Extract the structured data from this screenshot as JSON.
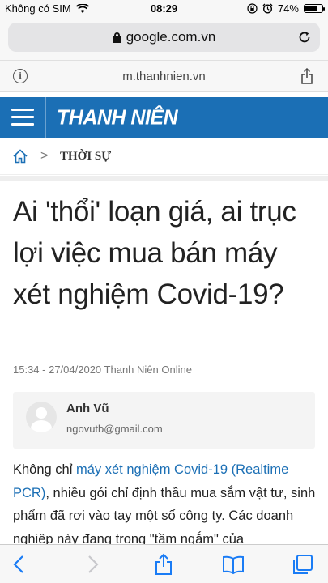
{
  "status_bar": {
    "carrier": "Không có SIM",
    "time": "08:29",
    "battery": "74%",
    "battery_level": 0.74,
    "icons": [
      "wifi-icon",
      "lock-rotation-icon",
      "alarm-icon",
      "battery-icon"
    ]
  },
  "browser": {
    "url": "google.com.vn",
    "amp_url": "m.thanhnien.vn",
    "icons": [
      "lock-icon",
      "reload-icon",
      "info-icon",
      "share-icon"
    ]
  },
  "site": {
    "logo": "THANH NIÊN",
    "brand_color": "#1b6fb5"
  },
  "breadcrumb": {
    "section": "THỜI SỰ",
    "separator": ">"
  },
  "article": {
    "title": "Ai 'thổi' loạn giá, ai trục lợi việc mua bán máy xét nghiệm Covid-19?",
    "time": "15:34",
    "date_source": " - 27/04/2020 Thanh Niên Online",
    "author": {
      "name": "Anh Vũ",
      "email": "ngovutb@gmail.com"
    },
    "body": {
      "prefix": "Không chỉ ",
      "link": "máy xét nghiệm Covid-19 (Realtime PCR)",
      "rest": ", nhiều gói chỉ định thầu mua sắm vật tư, sinh phẩm đã rơi vào tay một số công ty. Các doanh nghiệp này đang trong \"tầm ngắm\" của"
    }
  },
  "toolbar": {
    "icons": [
      "back-icon",
      "forward-icon",
      "share-icon",
      "bookmarks-icon",
      "tabs-icon"
    ]
  }
}
